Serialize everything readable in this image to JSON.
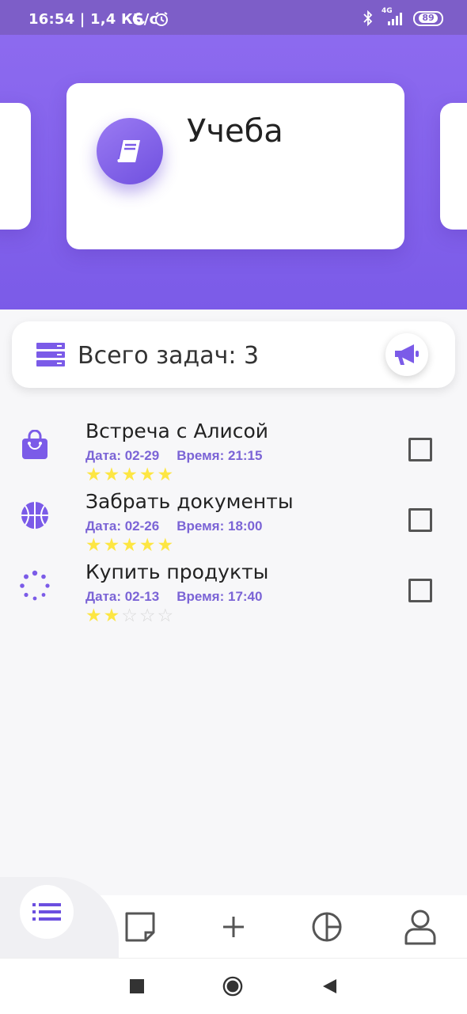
{
  "status_bar": {
    "time": "16:54 | 1,4 КБ/с",
    "network": "4G",
    "battery": "89"
  },
  "category": {
    "title": "Учеба",
    "icon": "book-icon"
  },
  "summary": {
    "text": "Всего задач: 3",
    "icon": "list-stack-icon",
    "action_icon": "megaphone-icon"
  },
  "tasks": [
    {
      "title": "Встреча с Алисой",
      "date": "Дата: 02-29",
      "time": "Время: 21:15",
      "rating": 5,
      "icon": "shopping-bag-icon",
      "done": false
    },
    {
      "title": "Забрать документы",
      "date": "Дата: 02-26",
      "time": "Время: 18:00",
      "rating": 5,
      "icon": "basketball-icon",
      "done": false
    },
    {
      "title": "Купить продукты",
      "date": "Дата: 02-13",
      "time": "Время: 17:40",
      "rating": 2,
      "icon": "spinner-icon",
      "done": false
    }
  ],
  "rating_max": 5,
  "bottom_nav": [
    "list-icon",
    "note-icon",
    "plus-icon",
    "pie-chart-icon",
    "user-icon"
  ],
  "colors": {
    "accent": "#7b5be8",
    "meta": "#7b64d6",
    "star": "#fde643"
  }
}
